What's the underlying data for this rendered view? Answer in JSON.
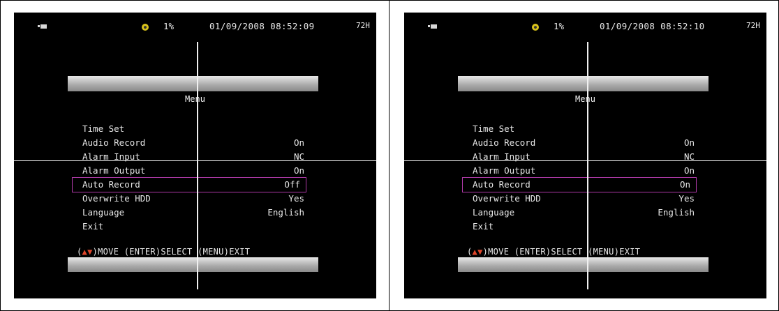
{
  "screens": [
    {
      "status": {
        "disk_pct": "1%",
        "datetime": "01/09/2008 08:52:09",
        "rec_hours": "72H"
      },
      "menu": {
        "title": "Menu",
        "items": [
          {
            "label": "Time Set",
            "value": ""
          },
          {
            "label": "Audio Record",
            "value": "On"
          },
          {
            "label": "Alarm Input",
            "value": "NC"
          },
          {
            "label": "Alarm Output",
            "value": "On"
          },
          {
            "label": "Auto Record",
            "value": "Off"
          },
          {
            "label": "Overwrite HDD",
            "value": "Yes"
          },
          {
            "label": "Language",
            "value": "English"
          },
          {
            "label": "Exit",
            "value": ""
          }
        ],
        "selected_index": 4,
        "hint_open": "(",
        "hint_rest": ")MOVE (ENTER)SELECT (MENU)EXIT"
      }
    },
    {
      "status": {
        "disk_pct": "1%",
        "datetime": "01/09/2008 08:52:10",
        "rec_hours": "72H"
      },
      "menu": {
        "title": "Menu",
        "items": [
          {
            "label": "Time Set",
            "value": ""
          },
          {
            "label": "Audio Record",
            "value": "On"
          },
          {
            "label": "Alarm Input",
            "value": "NC"
          },
          {
            "label": "Alarm Output",
            "value": "On"
          },
          {
            "label": "Auto Record",
            "value": "On"
          },
          {
            "label": "Overwrite HDD",
            "value": "Yes"
          },
          {
            "label": "Language",
            "value": "English"
          },
          {
            "label": "Exit",
            "value": ""
          }
        ],
        "selected_index": 4,
        "hint_open": "(",
        "hint_rest": ")MOVE (ENTER)SELECT (MENU)EXIT"
      }
    }
  ],
  "icons": {
    "camera": "camera-icon",
    "hdd": "hdd-icon",
    "nav_arrows": "up-down-arrows-icon"
  },
  "colors": {
    "selection_outline": "#b03aa8",
    "arrow": "#e0452a",
    "hdd_icon": "#d8c21a"
  }
}
